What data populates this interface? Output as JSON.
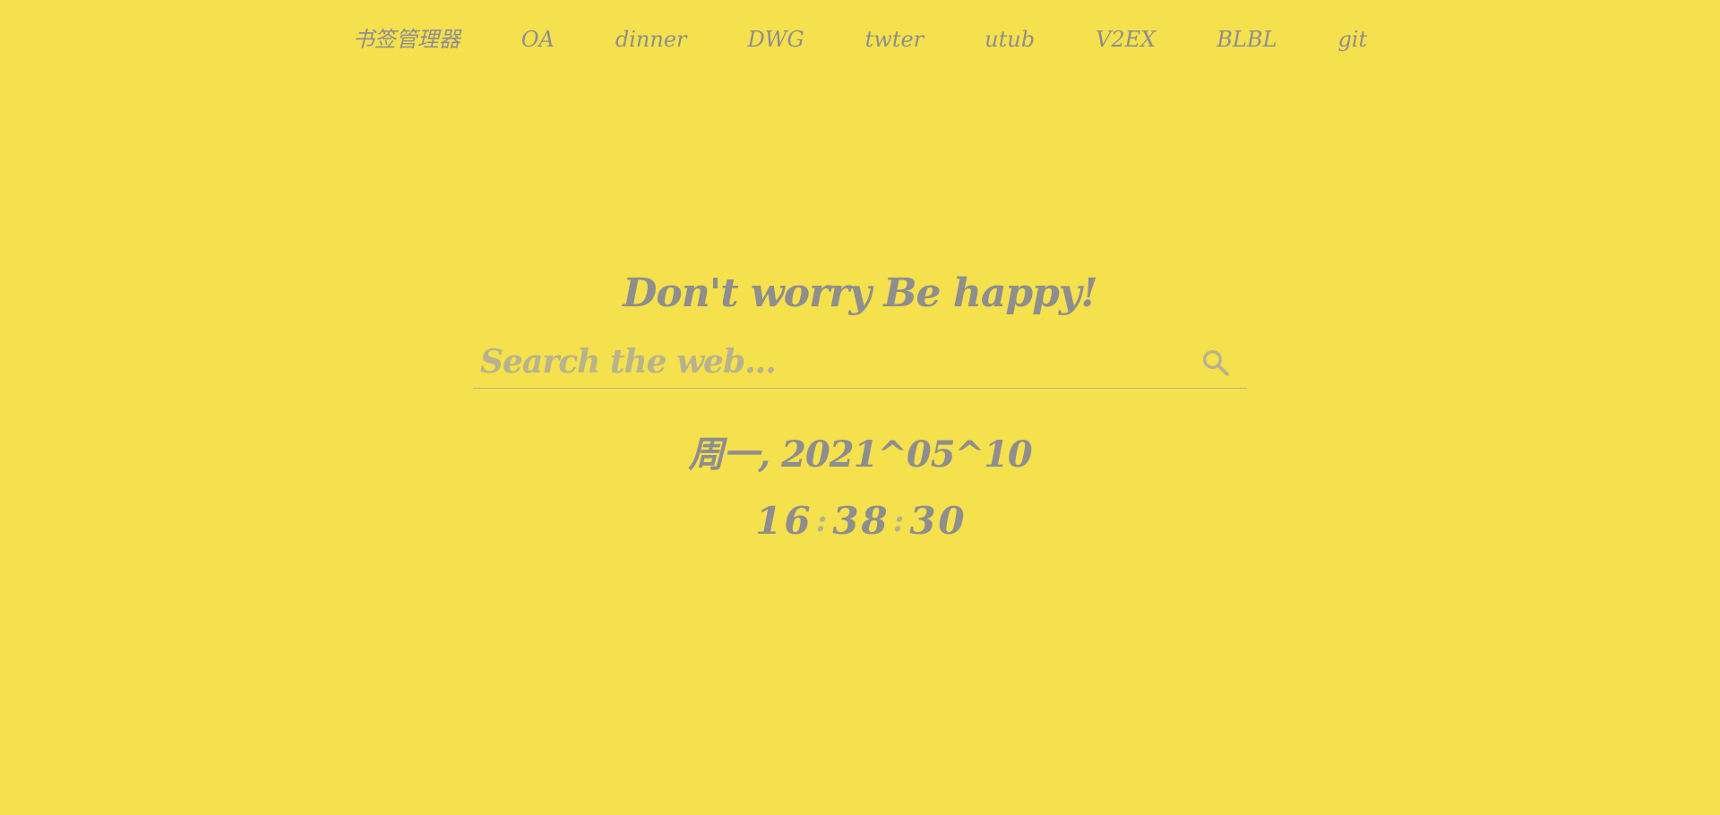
{
  "nav": {
    "links": [
      {
        "label": "书签管理器"
      },
      {
        "label": "OA"
      },
      {
        "label": "dinner"
      },
      {
        "label": "DWG"
      },
      {
        "label": "twter"
      },
      {
        "label": "utub"
      },
      {
        "label": "V2EX"
      },
      {
        "label": "BLBL"
      },
      {
        "label": "git"
      }
    ]
  },
  "hero": {
    "motto": "Don't worry Be happy!"
  },
  "search": {
    "placeholder": "Search the web...",
    "value": "",
    "icon": "search-icon"
  },
  "date": {
    "text": "周一, 2021^05^10"
  },
  "clock": {
    "h1": "1",
    "h2": "6",
    "sep1": ":",
    "m1": "3",
    "m2": "8",
    "sep2": ":",
    "s1": "3",
    "s2": "0"
  },
  "colors": {
    "background": "#F5E04D",
    "text": "#8E8E8E",
    "muted": "#B7B38C"
  }
}
